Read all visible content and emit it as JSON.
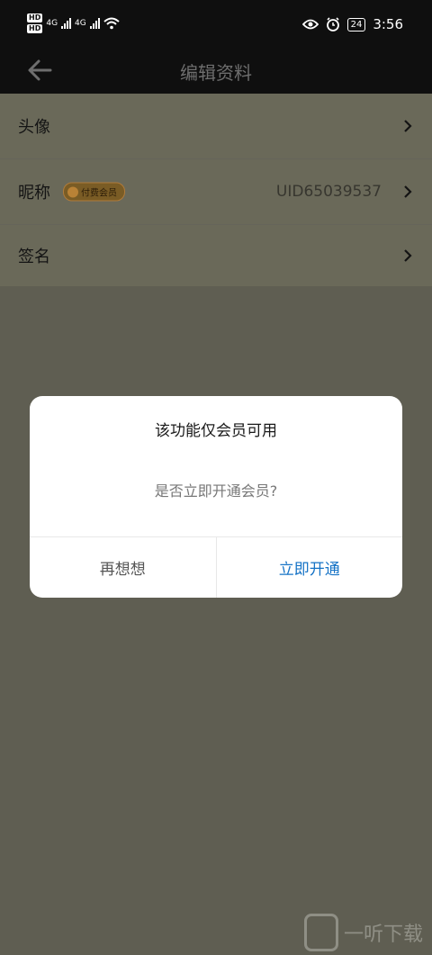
{
  "status_bar": {
    "network_a": "4G",
    "network_b": "4G",
    "hd_top": "HD",
    "hd_bottom": "HD",
    "battery": "24",
    "time": "3:56"
  },
  "header": {
    "title": "编辑资料",
    "back_icon": "arrow-left-icon"
  },
  "settings": {
    "rows": [
      {
        "label": "头像"
      },
      {
        "label": "昵称",
        "badge": "付费会员",
        "value": "UID65039537"
      },
      {
        "label": "签名"
      }
    ]
  },
  "dialog": {
    "title": "该功能仅会员可用",
    "message": "是否立即开通会员?",
    "cancel_label": "再想想",
    "confirm_label": "立即开通"
  },
  "watermark": {
    "text": "一听下载"
  },
  "colors": {
    "overlay": "#5f5e52",
    "confirm": "#1673c6",
    "header_bg": "#0f0f0f"
  }
}
